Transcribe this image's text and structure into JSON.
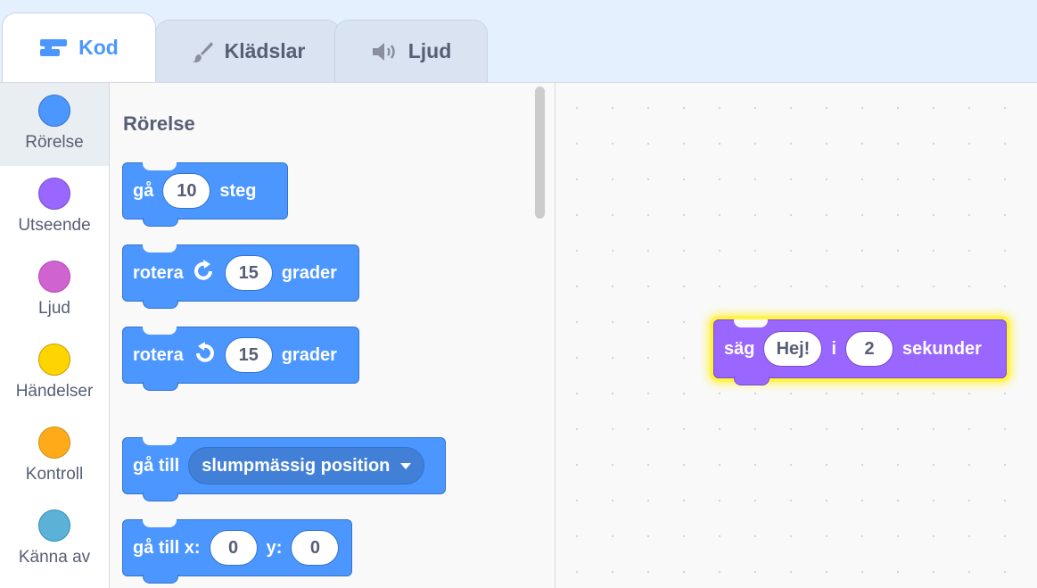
{
  "tabs": [
    {
      "label": "Kod",
      "icon": "code-icon",
      "active": true
    },
    {
      "label": "Klädslar",
      "icon": "brush-icon",
      "active": false
    },
    {
      "label": "Ljud",
      "icon": "speaker-icon",
      "active": false
    }
  ],
  "categories": [
    {
      "label": "Rörelse",
      "color": "#4c97ff",
      "border": "#3373cc"
    },
    {
      "label": "Utseende",
      "color": "#9966ff",
      "border": "#774dcb"
    },
    {
      "label": "Ljud",
      "color": "#cf63cf",
      "border": "#bd42bd"
    },
    {
      "label": "Händelser",
      "color": "#ffd500",
      "border": "#cc9900"
    },
    {
      "label": "Kontroll",
      "color": "#ffab19",
      "border": "#cf8b17"
    },
    {
      "label": "Känna av",
      "color": "#5cb1d6",
      "border": "#2e8eb8"
    }
  ],
  "flyout": {
    "title": "Rörelse",
    "move": {
      "text": "gå",
      "value": "10",
      "suffix": "steg"
    },
    "turn_right": {
      "text": "rotera",
      "value": "15",
      "suffix": "grader"
    },
    "turn_left": {
      "text": "rotera",
      "value": "15",
      "suffix": "grader"
    },
    "goto": {
      "text": "gå till",
      "dropdown": "slumpmässig position"
    },
    "goto_xy": {
      "text": "gå till x:",
      "x": "0",
      "y_label": "y:",
      "y": "0"
    }
  },
  "script": {
    "say_block": {
      "text": "säg",
      "message": "Hej!",
      "mid": "i",
      "seconds": "2",
      "suffix": "sekunder",
      "color": "#9966ff",
      "highlight": "#fff34a"
    }
  }
}
